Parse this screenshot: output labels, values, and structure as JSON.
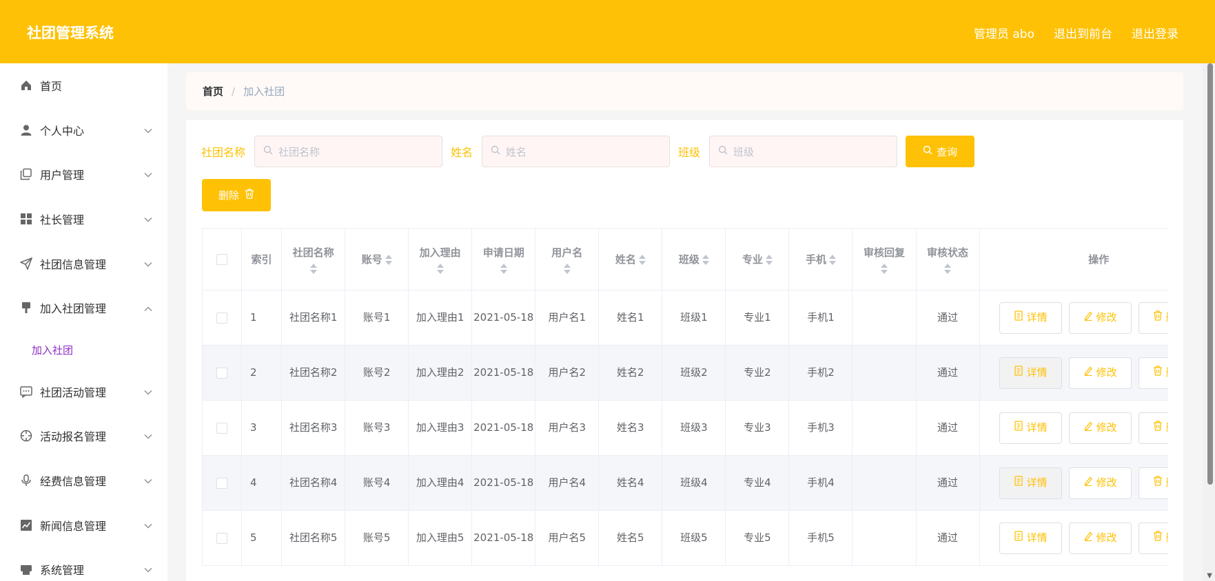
{
  "header": {
    "brand": "社团管理系统",
    "admin": "管理员 abo",
    "exit_front": "退出到前台",
    "logout": "退出登录"
  },
  "sidebar": {
    "items": [
      {
        "label": "首页",
        "icon": "home-icon"
      },
      {
        "label": "个人中心",
        "icon": "user-icon"
      },
      {
        "label": "用户管理",
        "icon": "copy-icon"
      },
      {
        "label": "社长管理",
        "icon": "grid-icon"
      },
      {
        "label": "社团信息管理",
        "icon": "send-icon"
      },
      {
        "label": "加入社团管理",
        "icon": "pin-icon"
      },
      {
        "label": "社团活动管理",
        "icon": "chat-icon"
      },
      {
        "label": "活动报名管理",
        "icon": "target-icon"
      },
      {
        "label": "经费信息管理",
        "icon": "mic-icon"
      },
      {
        "label": "新闻信息管理",
        "icon": "chart-icon"
      },
      {
        "label": "系统管理",
        "icon": "printer-icon"
      }
    ],
    "sub_item": "加入社团"
  },
  "breadcrumb": {
    "home": "首页",
    "sep": "/",
    "current": "加入社团"
  },
  "search": {
    "club_label": "社团名称",
    "club_placeholder": "社团名称",
    "name_label": "姓名",
    "name_placeholder": "姓名",
    "class_label": "班级",
    "class_placeholder": "班级",
    "query_label": "查询"
  },
  "delete_label": "删除",
  "table": {
    "headers": {
      "index": "索引",
      "club": "社团名称",
      "account": "账号",
      "reason": "加入理由",
      "date": "申请日期",
      "username": "用户名",
      "name": "姓名",
      "class": "班级",
      "major": "专业",
      "phone": "手机",
      "reply": "审核回复",
      "status": "审核状态",
      "ops": "操作"
    },
    "actions": {
      "detail": "详情",
      "edit": "修改",
      "delete": "删除"
    },
    "rows": [
      {
        "index": "1",
        "club": "社团名称1",
        "account": "账号1",
        "reason": "加入理由1",
        "date": "2021-05-18",
        "username": "用户名1",
        "name": "姓名1",
        "class": "班级1",
        "major": "专业1",
        "phone": "手机1",
        "reply": "",
        "status": "通过"
      },
      {
        "index": "2",
        "club": "社团名称2",
        "account": "账号2",
        "reason": "加入理由2",
        "date": "2021-05-18",
        "username": "用户名2",
        "name": "姓名2",
        "class": "班级2",
        "major": "专业2",
        "phone": "手机2",
        "reply": "",
        "status": "通过"
      },
      {
        "index": "3",
        "club": "社团名称3",
        "account": "账号3",
        "reason": "加入理由3",
        "date": "2021-05-18",
        "username": "用户名3",
        "name": "姓名3",
        "class": "班级3",
        "major": "专业3",
        "phone": "手机3",
        "reply": "",
        "status": "通过"
      },
      {
        "index": "4",
        "club": "社团名称4",
        "account": "账号4",
        "reason": "加入理由4",
        "date": "2021-05-18",
        "username": "用户名4",
        "name": "姓名4",
        "class": "班级4",
        "major": "专业4",
        "phone": "手机4",
        "reply": "",
        "status": "通过"
      },
      {
        "index": "5",
        "club": "社团名称5",
        "account": "账号5",
        "reason": "加入理由5",
        "date": "2021-05-18",
        "username": "用户名5",
        "name": "姓名5",
        "class": "班级5",
        "major": "专业5",
        "phone": "手机5",
        "reply": "",
        "status": "通过"
      }
    ]
  },
  "colors": {
    "accent": "#fec105",
    "sub_item": "#8e2ec4"
  }
}
